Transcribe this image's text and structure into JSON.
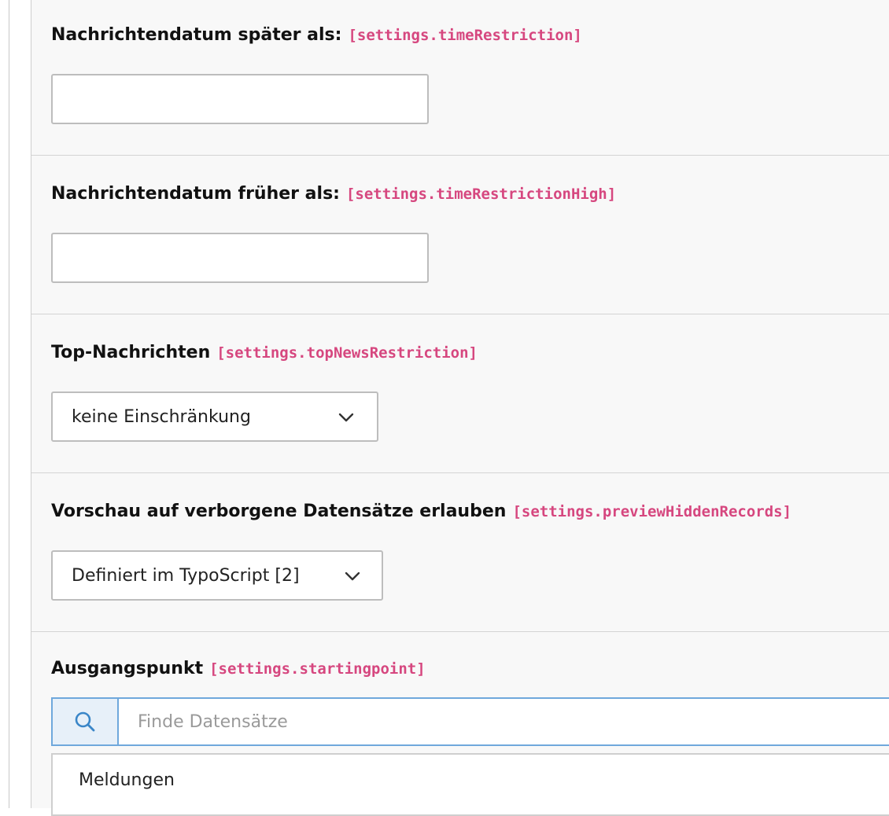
{
  "fields": [
    {
      "label": "Nachrichtendatum später als:",
      "key": "[settings.timeRestriction]",
      "value": ""
    },
    {
      "label": "Nachrichtendatum früher als:",
      "key": "[settings.timeRestrictionHigh]",
      "value": ""
    },
    {
      "label": "Top-Nachrichten",
      "key": "[settings.topNewsRestriction]",
      "selected": "keine Einschränkung"
    },
    {
      "label": "Vorschau auf verborgene Datensätze erlauben",
      "key": "[settings.previewHiddenRecords]",
      "selected": "Definiert im TypoScript [2]"
    },
    {
      "label": "Ausgangspunkt",
      "key": "[settings.startingpoint]"
    }
  ],
  "search": {
    "placeholder": "Finde Datensätze",
    "icon": "search-icon"
  },
  "records": [
    "Meldungen"
  ],
  "colors": {
    "key_accent": "#d6477f",
    "focus_border": "#6fa8dc",
    "addon_bg": "#e7f0f9"
  }
}
